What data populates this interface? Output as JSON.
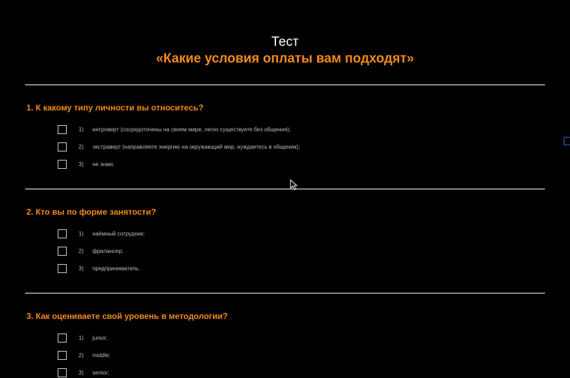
{
  "header": {
    "subtitle": "Тест",
    "title": "«Какие условия оплаты вам подходят»"
  },
  "questions": [
    {
      "title": "1. К какому типу личности вы относитесь?",
      "options": [
        {
          "num": "1)",
          "text": "интроверт (сосредоточены на своем мире, легко существуете без общения);"
        },
        {
          "num": "2)",
          "text": "экстраверт (направляете энергию на окружающий мир, нуждаетесь в общении);"
        },
        {
          "num": "3)",
          "text": "не знаю."
        }
      ]
    },
    {
      "title": "2. Кто вы по форме занятости?",
      "options": [
        {
          "num": "1)",
          "text": "наёмный сотрудник;"
        },
        {
          "num": "2)",
          "text": "фрилансер;"
        },
        {
          "num": "3)",
          "text": "предприниматель."
        }
      ]
    },
    {
      "title": "3. Как оцениваете свой уровень в методологии?",
      "options": [
        {
          "num": "1)",
          "text": "junior;"
        },
        {
          "num": "2)",
          "text": "middle;"
        },
        {
          "num": "3)",
          "text": "senior;"
        }
      ]
    }
  ],
  "colors": {
    "background": "#000000",
    "accent": "#f28a1e",
    "divider": "#8a8a8a",
    "option_text": "#bdbdbd"
  },
  "icons": {
    "checkbox": "checkbox-icon",
    "cursor": "mouse-pointer-icon"
  }
}
